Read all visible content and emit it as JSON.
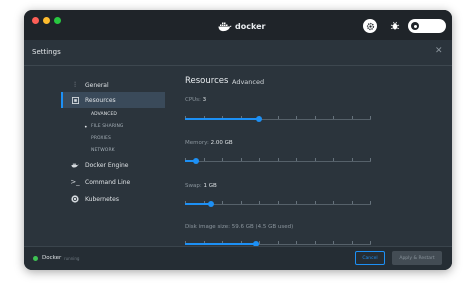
{
  "app": {
    "brand": "docker",
    "window_title": "Settings"
  },
  "sidebar": {
    "items": [
      {
        "label": "General",
        "icon": "sliders-icon"
      },
      {
        "label": "Resources",
        "icon": "resources-icon"
      },
      {
        "label": "Docker Engine",
        "icon": "whale-icon"
      },
      {
        "label": "Command Line",
        "icon": "terminal-icon"
      },
      {
        "label": "Kubernetes",
        "icon": "helm-icon"
      }
    ],
    "subitems": [
      "ADVANCED",
      "FILE SHARING",
      "PROXIES",
      "NETWORK"
    ]
  },
  "main": {
    "title": "Resources",
    "subtitle": "Advanced",
    "cpus": {
      "label": "CPUs:",
      "value": "3",
      "fraction": 0.4
    },
    "memory": {
      "label": "Memory:",
      "value": "2.00 GB",
      "fraction": 0.06
    },
    "swap": {
      "label": "Swap:",
      "value": "1 GB",
      "fraction": 0.14
    },
    "disk": {
      "label": "Disk image size:",
      "value": "59.6 GB (4.5 GB used)",
      "fraction": 0.38
    }
  },
  "footer": {
    "status_name": "Docker",
    "status_text": "running",
    "cancel_label": "Cancel",
    "apply_label": "Apply & Restart"
  },
  "colors": {
    "accent": "#1d90f5",
    "running": "#3ec253",
    "panel": "#2b343c"
  }
}
